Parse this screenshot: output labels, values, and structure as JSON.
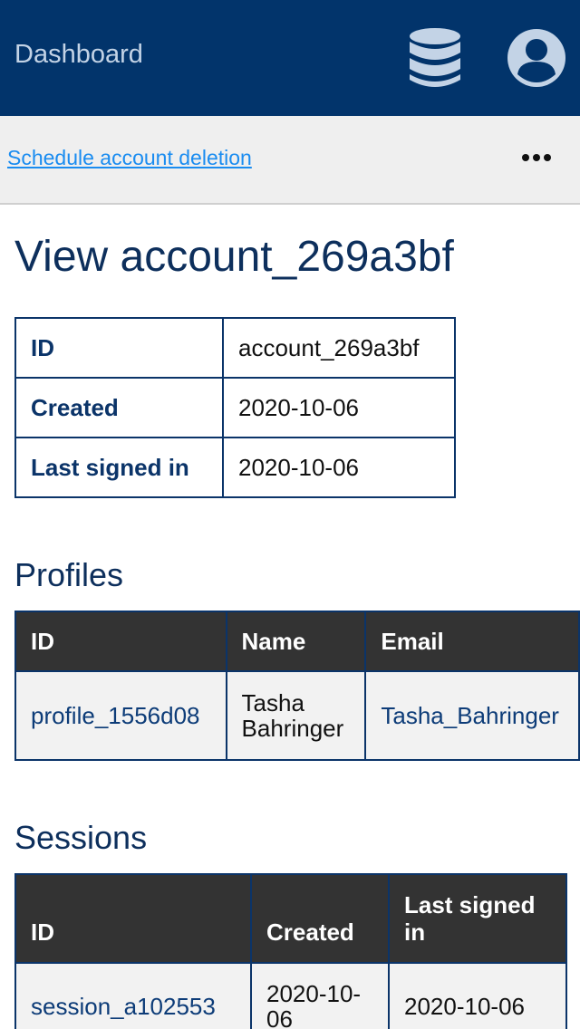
{
  "topbar": {
    "title": "Dashboard",
    "database_icon": "database-icon",
    "user_icon": "user-account-icon"
  },
  "actions": {
    "schedule_deletion": "Schedule account deletion",
    "more_icon": "more-horizontal-icon"
  },
  "page": {
    "title": "View account_269a3bf"
  },
  "account": {
    "rows": [
      {
        "label": "ID",
        "value": "account_269a3bf"
      },
      {
        "label": "Created",
        "value": "2020-10-06"
      },
      {
        "label": "Last signed in",
        "value": "2020-10-06"
      }
    ]
  },
  "profiles": {
    "heading": "Profiles",
    "columns": [
      "ID",
      "Name",
      "Email"
    ],
    "rows": [
      {
        "id": "profile_1556d08",
        "name": "Tasha Bahringer",
        "email": "Tasha_Bahringer"
      }
    ]
  },
  "sessions": {
    "heading": "Sessions",
    "columns": [
      "ID",
      "Created",
      "Last signed in"
    ],
    "rows": [
      {
        "id": "session_a102553",
        "created": "2020-10-06",
        "last_signed_in": "2020-10-06"
      }
    ]
  },
  "colors": {
    "topbar": "#02346b",
    "link": "#1a8cf0",
    "header_dark": "#333333",
    "text_navy": "#0d2f5c"
  }
}
